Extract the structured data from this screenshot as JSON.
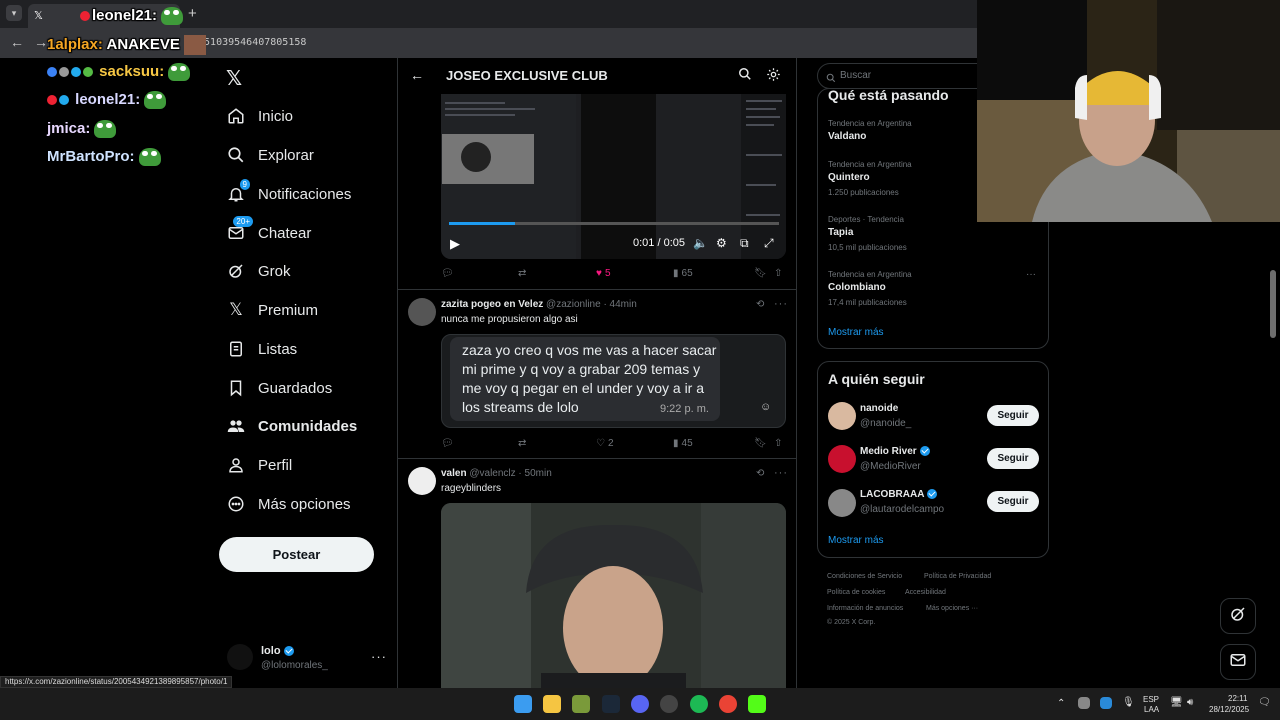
{
  "browser": {
    "tab_title": "leonel21:",
    "url": "1851039546407805158",
    "tab_close": "✕",
    "new_tab": "+"
  },
  "chat": {
    "lines": [
      {
        "user": "1alplax:",
        "text": "ANAKEVE"
      },
      {
        "user": "sacksuu:",
        "text": ""
      },
      {
        "user": "leonel21:",
        "text": ""
      },
      {
        "user": "jmica:",
        "text": ""
      },
      {
        "user": "MrBartoPro:",
        "text": ""
      }
    ]
  },
  "nav": {
    "logo": "𝕏",
    "items": [
      {
        "label": "Inicio",
        "icon": "home-icon"
      },
      {
        "label": "Explorar",
        "icon": "search-icon"
      },
      {
        "label": "Notificaciones",
        "icon": "bell-icon",
        "badge": "9"
      },
      {
        "label": "Chatear",
        "icon": "mail-icon",
        "badge": "20+"
      },
      {
        "label": "Grok",
        "icon": "grok-icon"
      },
      {
        "label": "Premium",
        "icon": "x-icon"
      },
      {
        "label": "Listas",
        "icon": "list-icon"
      },
      {
        "label": "Guardados",
        "icon": "bookmark-icon"
      },
      {
        "label": "Comunidades",
        "icon": "people-icon"
      },
      {
        "label": "Perfil",
        "icon": "person-icon"
      },
      {
        "label": "Más opciones",
        "icon": "more-icon"
      }
    ],
    "post_button": "Postear",
    "account": {
      "name": "lolo",
      "handle": "@lolomorales_",
      "more": "···"
    }
  },
  "main": {
    "title": "JOSEO EXCLUSIVE CLUB",
    "video": {
      "time": "0:01 / 0:05",
      "progress": 0.2
    },
    "post1_actions": {
      "replies": "",
      "retweets": "",
      "likes": "5",
      "views": "65"
    },
    "tweet2": {
      "name": "zazita pogeo en Velez",
      "meta": "@zazionline · 44min",
      "text": "nunca me propusieron algo asi",
      "image_text": "zaza yo creo q vos me vas a hacer sacar mi prime y q voy a grabar 209 temas y me voy q pegar en el under y voy a ir a los streams de lolo",
      "image_time": "9:22 p. m.",
      "actions": {
        "replies": "",
        "retweets": "",
        "likes": "2",
        "views": "45"
      }
    },
    "tweet3": {
      "name": "valen",
      "meta": "@valenclz · 50min",
      "text": "rageyblinders"
    }
  },
  "right": {
    "search_placeholder": "Buscar",
    "trends_title": "Qué está pasando",
    "trends": [
      {
        "context": "Tendencia en Argentina",
        "name": "Valdano",
        "count": ""
      },
      {
        "context": "Tendencia en Argentina",
        "name": "Quintero",
        "count": "1.250 publicaciones"
      },
      {
        "context": "Deportes · Tendencia",
        "name": "Tapia",
        "count": "10,5 mil publicaciones"
      },
      {
        "context": "Tendencia en Argentina",
        "name": "Colombiano",
        "count": "17,4 mil publicaciones"
      }
    ],
    "show_more": "Mostrar más",
    "who_title": "A quién seguir",
    "who": [
      {
        "name": "nanoide",
        "handle": "@nanoide_",
        "verified": false,
        "color": "#d9b9a0"
      },
      {
        "name": "Medio River",
        "handle": "@MedioRiver",
        "verified": true,
        "color": "#c8102e"
      },
      {
        "name": "LACOBRAAA",
        "handle": "@lautarodelcampo",
        "verified": true,
        "color": "#888888"
      }
    ],
    "follow_label": "Seguir",
    "footer": [
      "Condiciones de Servicio",
      "Política de Privacidad",
      "Política de cookies",
      "Accesibilidad",
      "Información de anuncios",
      "Más opciones ···",
      "© 2025 X Corp."
    ]
  },
  "status_url": "https://x.com/zazionline/status/2005434921389895857/photo/1",
  "taskbar": {
    "lang": "ESP",
    "lang2": "LAA",
    "time": "22:11",
    "date": "28/12/2025"
  },
  "colors": {
    "accent": "#1d9bf0",
    "like": "#f91880",
    "border": "#2f3336"
  }
}
